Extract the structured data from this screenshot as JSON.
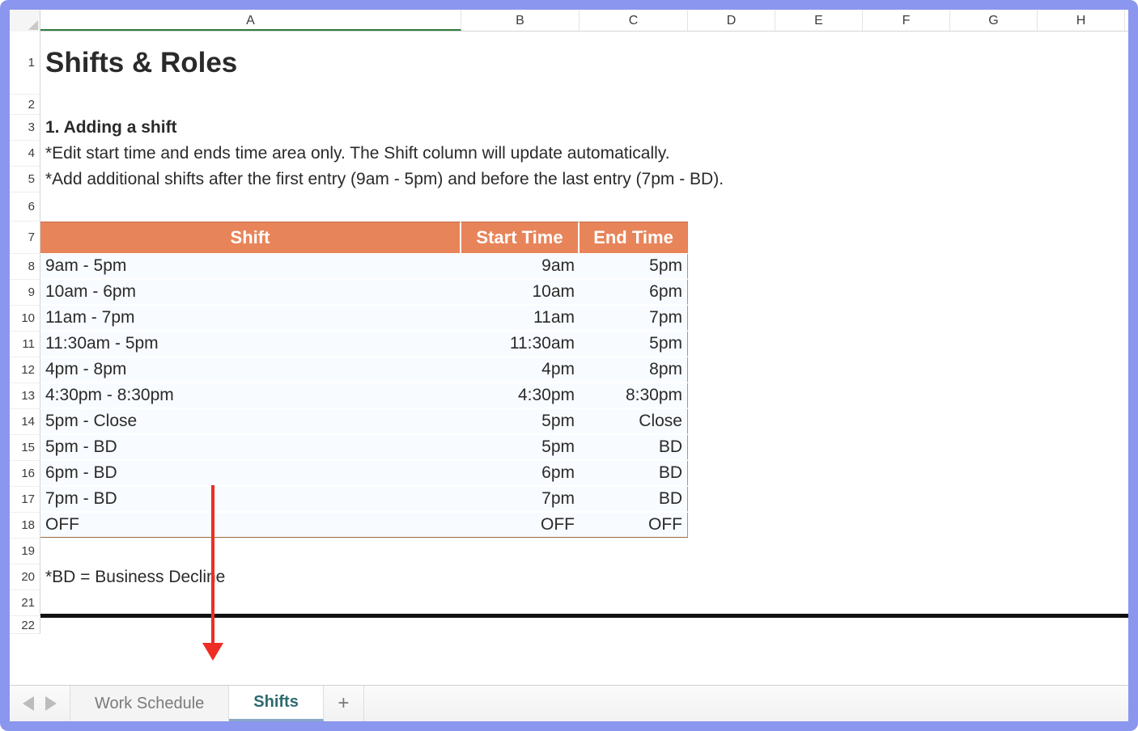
{
  "columns": [
    "A",
    "B",
    "C",
    "D",
    "E",
    "F",
    "G",
    "H"
  ],
  "rowNumbers": [
    1,
    2,
    3,
    4,
    5,
    6,
    7,
    8,
    9,
    10,
    11,
    12,
    13,
    14,
    15,
    16,
    17,
    18,
    19,
    20,
    21,
    22
  ],
  "title": "Shifts & Roles",
  "section_heading": "1. Adding a shift",
  "note1": "*Edit start time and ends time area only. The Shift column will update automatically.",
  "note2": "*Add additional shifts after the first entry (9am - 5pm) and before the last entry (7pm - BD).",
  "table": {
    "headers": {
      "shift": "Shift",
      "start": "Start Time",
      "end": "End Time"
    },
    "rows": [
      {
        "shift": "9am - 5pm",
        "start": "9am",
        "end": "5pm"
      },
      {
        "shift": "10am - 6pm",
        "start": "10am",
        "end": "6pm"
      },
      {
        "shift": "11am - 7pm",
        "start": "11am",
        "end": "7pm"
      },
      {
        "shift": "11:30am - 5pm",
        "start": "11:30am",
        "end": "5pm"
      },
      {
        "shift": "4pm - 8pm",
        "start": "4pm",
        "end": "8pm"
      },
      {
        "shift": "4:30pm - 8:30pm",
        "start": "4:30pm",
        "end": "8:30pm"
      },
      {
        "shift": "5pm - Close",
        "start": "5pm",
        "end": "Close"
      },
      {
        "shift": "5pm - BD",
        "start": "5pm",
        "end": "BD"
      },
      {
        "shift": "6pm - BD",
        "start": "6pm",
        "end": "BD"
      },
      {
        "shift": "7pm - BD",
        "start": "7pm",
        "end": "BD"
      },
      {
        "shift": "OFF",
        "start": "OFF",
        "end": "OFF"
      }
    ]
  },
  "legend": "*BD = Business Decline",
  "tabs": {
    "items": [
      "Work Schedule",
      "Shifts"
    ],
    "active": "Shifts",
    "add_label": "+"
  },
  "chart_data": {
    "type": "table",
    "title": "Shifts & Roles",
    "columns": [
      "Shift",
      "Start Time",
      "End Time"
    ],
    "rows": [
      [
        "9am - 5pm",
        "9am",
        "5pm"
      ],
      [
        "10am - 6pm",
        "10am",
        "6pm"
      ],
      [
        "11am - 7pm",
        "11am",
        "7pm"
      ],
      [
        "11:30am - 5pm",
        "11:30am",
        "5pm"
      ],
      [
        "4pm - 8pm",
        "4pm",
        "8pm"
      ],
      [
        "4:30pm - 8:30pm",
        "4:30pm",
        "8:30pm"
      ],
      [
        "5pm - Close",
        "5pm",
        "Close"
      ],
      [
        "5pm - BD",
        "5pm",
        "BD"
      ],
      [
        "6pm - BD",
        "6pm",
        "BD"
      ],
      [
        "7pm - BD",
        "7pm",
        "BD"
      ],
      [
        "OFF",
        "OFF",
        "OFF"
      ]
    ]
  }
}
